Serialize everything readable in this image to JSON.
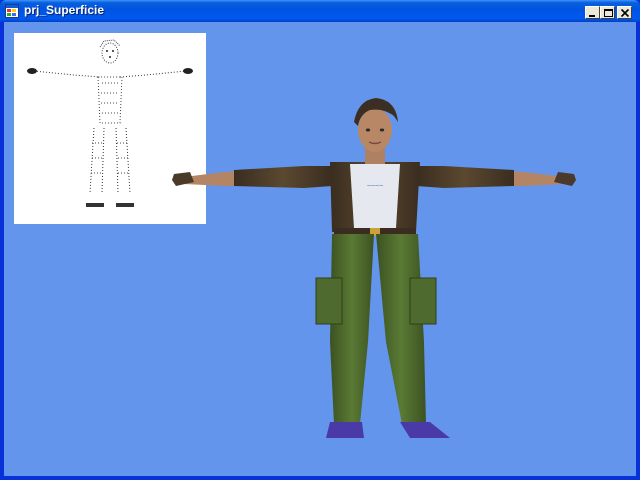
{
  "window": {
    "title": "prj_Superficie",
    "icons": {
      "app": "app-window-icon",
      "minimize": "minimize-icon",
      "maximize": "maximize-icon",
      "close": "close-icon"
    }
  },
  "viewport": {
    "background": "#6495ed",
    "preview_background": "#ffffff"
  },
  "colors": {
    "titlebar": "#0054e3",
    "title_text": "#ffffff",
    "jacket": "#4a3a28",
    "shirt": "#e8eaf0",
    "pants": "#4f6a2e",
    "shoes": "#4a3aa8",
    "skin": "#b88866"
  }
}
